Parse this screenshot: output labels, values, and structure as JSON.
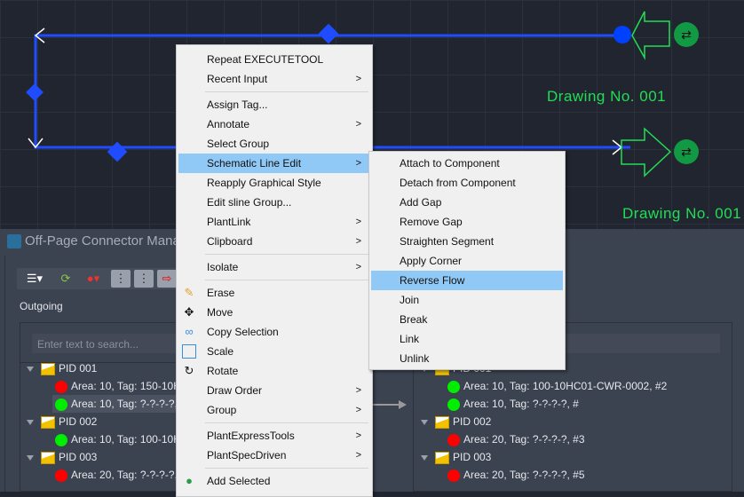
{
  "canvas": {
    "labels": [
      "Drawing No. 001",
      "Drawing No. 001"
    ],
    "line_color": "#1f4cff",
    "connector_color": "#22dd55"
  },
  "panel": {
    "title": "Off-Page Connector Manage",
    "outgoing_label": "Outgoing",
    "search_placeholder": "Enter text to search...",
    "left_tree": [
      {
        "pid": "PID 001",
        "items": [
          {
            "status": "red",
            "text": "Area: 10, Tag: 150-10HC"
          },
          {
            "status": "green",
            "text": "Area: 10, Tag: ?-?-?-?, #",
            "selected": true
          }
        ]
      },
      {
        "pid": "PID 002",
        "items": [
          {
            "status": "green",
            "text": "Area: 10, Tag: 100-10HC"
          }
        ]
      },
      {
        "pid": "PID 003",
        "items": [
          {
            "status": "red",
            "text": "Area: 20, Tag: ?-?-?-?, #"
          }
        ]
      }
    ],
    "right_tree": [
      {
        "pid": "PID 001",
        "items": [
          {
            "status": "green",
            "text": "Area: 10, Tag: 100-10HC01-CWR-0002, #2"
          },
          {
            "status": "green",
            "text": "Area: 10, Tag: ?-?-?-?, #"
          }
        ]
      },
      {
        "pid": "PID 002",
        "items": [
          {
            "status": "red",
            "text": "Area: 20, Tag: ?-?-?-?, #3"
          }
        ]
      },
      {
        "pid": "PID 003",
        "items": [
          {
            "status": "red",
            "text": "Area: 20, Tag: ?-?-?-?, #5"
          }
        ]
      }
    ],
    "status_colors": {
      "red": "#ff0000",
      "green": "#00ee00"
    }
  },
  "context_menu": {
    "items": [
      "Repeat EXECUTETOOL",
      "Recent Input",
      "Assign Tag...",
      "Annotate",
      "Select Group",
      "Schematic Line Edit",
      "Reapply Graphical Style",
      "Edit sline Group...",
      "PlantLink",
      "Clipboard",
      "Isolate",
      "Erase",
      "Move",
      "Copy Selection",
      "Scale",
      "Rotate",
      "Draw Order",
      "Group",
      "PlantExpressTools",
      "PlantSpecDriven",
      "Add Selected"
    ],
    "highlighted": "Schematic Line Edit"
  },
  "submenu": {
    "items": [
      "Attach to Component",
      "Detach from Component",
      "Add Gap",
      "Remove Gap",
      "Straighten Segment",
      "Apply Corner",
      "Reverse Flow",
      "Join",
      "Break",
      "Link",
      "Unlink"
    ],
    "highlighted": "Reverse Flow"
  }
}
